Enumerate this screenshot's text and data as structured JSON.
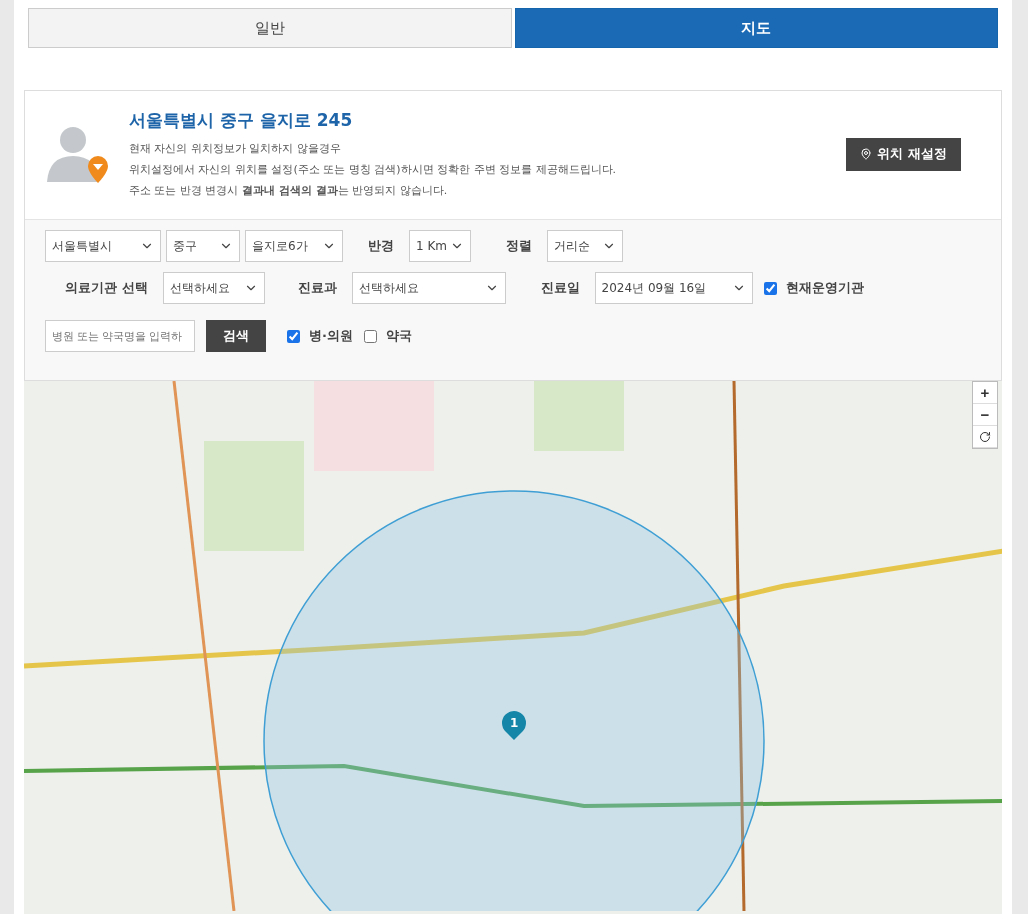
{
  "tabs": [
    {
      "label": "일반",
      "selected": false
    },
    {
      "label": "지도",
      "selected": true
    }
  ],
  "location": {
    "address": "서울특별시 중구 을지로 245",
    "notes": [
      "현재 자신의 위치정보가 일치하지 않을경우",
      "위치설정에서 자신의 위치를 설정(주소 또는 명칭 검색)하시면 정확한 주변 정보를 제공해드립니다.",
      "주소 또는 반경 변경시 **결과내 검색의 결과**는 반영되지 않습니다."
    ],
    "reset_button": "위치 재설정"
  },
  "filters": {
    "region": [
      "서울특별시",
      "중구",
      "을지로6가"
    ],
    "radius_label": "반경",
    "radius": "1 Km",
    "sort_label": "정렬",
    "sort": "거리순",
    "institution_label": "의료기관 선택",
    "institution": "선택하세요",
    "department_label": "진료과",
    "department": "선택하세요",
    "date_label": "진료일",
    "date": "2024년 09월 16일",
    "open_now": {
      "label": "현재운영기관",
      "checked": true
    },
    "search": {
      "placeholder": "병원 또는 약국명을 입력하",
      "button": "검색"
    },
    "types": [
      {
        "label": "병·의원",
        "checked": true
      },
      {
        "label": "약국",
        "checked": false
      }
    ]
  },
  "map": {
    "marker_label": "1",
    "zoom_in": "+",
    "zoom_out": "−"
  }
}
